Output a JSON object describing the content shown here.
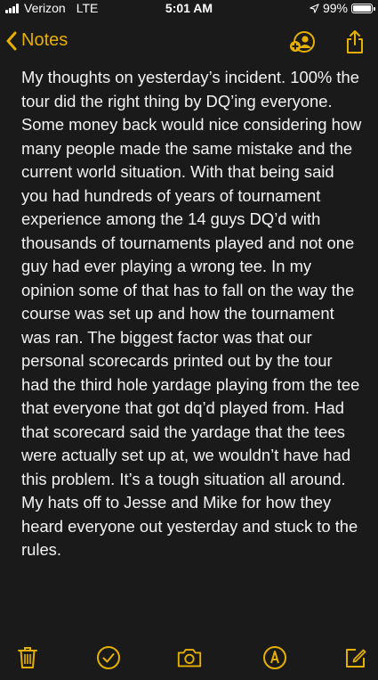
{
  "status_bar": {
    "carrier": "Verizon",
    "network": "LTE",
    "time": "5:01 AM",
    "battery_percent_label": "99%",
    "battery_level": 0.99,
    "signal_bars": 4,
    "location_active": true
  },
  "nav": {
    "back_label": "Notes",
    "icons": [
      "add-person-icon",
      "share-icon"
    ]
  },
  "note": {
    "text": "My thoughts on yesterday’s incident. 100% the tour did the right thing by DQ’ing everyone. Some money back would nice considering how many people made the same mistake and the current world situation. With that being said you had hundreds of years of tournament experience among the 14 guys DQ’d with thousands of tournaments played and not one guy had ever playing a wrong tee. In my opinion some of that has to fall on the way the course was set up and how the tournament was ran. The biggest factor was that our personal scorecards printed out by the tour had the third hole yardage playing from the tee that everyone that got dq’d played from. Had that scorecard said the yardage that the tees were actually set up at, we wouldn’t have had this problem. It’s a tough situation all around. My hats off to Jesse and Mike for how they heard everyone out yesterday and stuck to the rules."
  },
  "toolbar": {
    "icons": [
      "trash-icon",
      "checklist-icon",
      "camera-icon",
      "markup-icon",
      "compose-icon"
    ]
  },
  "colors": {
    "accent": "#e6b000",
    "background": "#1a1a1a",
    "text": "#f2f2f2"
  }
}
